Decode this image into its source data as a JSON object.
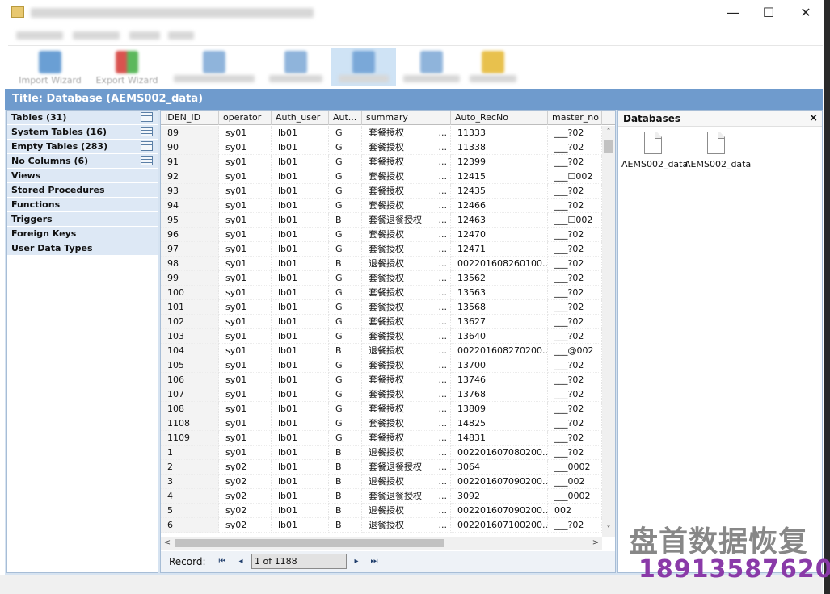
{
  "window": {
    "minimize_glyph": "—",
    "maximize_glyph": "☐",
    "close_glyph": "✕"
  },
  "ribbon": {
    "import_label": "Import Wizard",
    "export_label": "Export Wizard"
  },
  "title_band": "Title: Database (AEMS002_data)",
  "nav": {
    "items": [
      {
        "label": "Tables (31)",
        "has_grid_icon": true
      },
      {
        "label": "System Tables (16)",
        "has_grid_icon": true
      },
      {
        "label": "Empty Tables (283)",
        "has_grid_icon": true
      },
      {
        "label": "No Columns (6)",
        "has_grid_icon": true
      },
      {
        "label": "Views"
      },
      {
        "label": "Stored Procedures"
      },
      {
        "label": "Functions"
      },
      {
        "label": "Triggers"
      },
      {
        "label": "Foreign Keys"
      },
      {
        "label": "User Data Types"
      }
    ]
  },
  "grid": {
    "columns": [
      "IDEN_ID",
      "operator",
      "Auth_user",
      "Aut...",
      "summary",
      "Auto_RecNo",
      "master_no"
    ],
    "rows": [
      [
        "89",
        "sy01",
        "lb01",
        "G",
        "套餐授权",
        "11333",
        "___?02"
      ],
      [
        "90",
        "sy01",
        "lb01",
        "G",
        "套餐授权",
        "11338",
        "___?02"
      ],
      [
        "91",
        "sy01",
        "lb01",
        "G",
        "套餐授权",
        "12399",
        "___?02"
      ],
      [
        "92",
        "sy01",
        "lb01",
        "G",
        "套餐授权",
        "12415",
        "___☐002"
      ],
      [
        "93",
        "sy01",
        "lb01",
        "G",
        "套餐授权",
        "12435",
        "___?02"
      ],
      [
        "94",
        "sy01",
        "lb01",
        "G",
        "套餐授权",
        "12466",
        "___?02"
      ],
      [
        "95",
        "sy01",
        "lb01",
        "B",
        "套餐退餐授权",
        "12463",
        "___☐002"
      ],
      [
        "96",
        "sy01",
        "lb01",
        "G",
        "套餐授权",
        "12470",
        "___?02"
      ],
      [
        "97",
        "sy01",
        "lb01",
        "G",
        "套餐授权",
        "12471",
        "___?02"
      ],
      [
        "98",
        "sy01",
        "lb01",
        "B",
        "退餐授权",
        "002201608260100...",
        "___?02"
      ],
      [
        "99",
        "sy01",
        "lb01",
        "G",
        "套餐授权",
        "13562",
        "___?02"
      ],
      [
        "100",
        "sy01",
        "lb01",
        "G",
        "套餐授权",
        "13563",
        "___?02"
      ],
      [
        "101",
        "sy01",
        "lb01",
        "G",
        "套餐授权",
        "13568",
        "___?02"
      ],
      [
        "102",
        "sy01",
        "lb01",
        "G",
        "套餐授权",
        "13627",
        "___?02"
      ],
      [
        "103",
        "sy01",
        "lb01",
        "G",
        "套餐授权",
        "13640",
        "___?02"
      ],
      [
        "104",
        "sy01",
        "lb01",
        "B",
        "退餐授权",
        "002201608270200...",
        "___@002"
      ],
      [
        "105",
        "sy01",
        "lb01",
        "G",
        "套餐授权",
        "13700",
        "___?02"
      ],
      [
        "106",
        "sy01",
        "lb01",
        "G",
        "套餐授权",
        "13746",
        "___?02"
      ],
      [
        "107",
        "sy01",
        "lb01",
        "G",
        "套餐授权",
        "13768",
        "___?02"
      ],
      [
        "108",
        "sy01",
        "lb01",
        "G",
        "套餐授权",
        "13809",
        "___?02"
      ],
      [
        "1108",
        "sy01",
        "lb01",
        "G",
        "套餐授权",
        "14825",
        "___?02"
      ],
      [
        "1109",
        "sy01",
        "lb01",
        "G",
        "套餐授权",
        "14831",
        "___?02"
      ],
      [
        "1",
        "sy01",
        "lb01",
        "B",
        "退餐授权",
        "002201607080200...",
        "___?02"
      ],
      [
        "2",
        "sy02",
        "lb01",
        "B",
        "套餐退餐授权",
        "3064",
        "___0002"
      ],
      [
        "3",
        "sy02",
        "lb01",
        "B",
        "退餐授权",
        "002201607090200...",
        "___002"
      ],
      [
        "4",
        "sy02",
        "lb01",
        "B",
        "套餐退餐授权",
        "3092",
        "___0002"
      ],
      [
        "5",
        "sy02",
        "lb01",
        "B",
        "退餐授权",
        "002201607090200...",
        "002"
      ],
      [
        "6",
        "sy02",
        "lb01",
        "B",
        "退餐授权",
        "002201607100200...",
        "___?02"
      ]
    ],
    "ellipsis": "...",
    "scroll_up_glyph": "˄",
    "scroll_down_glyph": "˅",
    "scroll_left_glyph": "<",
    "scroll_right_glyph": ">"
  },
  "record_nav": {
    "label": "Record:",
    "position": "1 of 1188",
    "first_glyph": "⏮",
    "prev_glyph": "◂",
    "next_glyph": "▸",
    "last_glyph": "⏭"
  },
  "databases_panel": {
    "title": "Databases",
    "close_glyph": "×",
    "items": [
      "AEMS002_data",
      "AEMS002_data"
    ]
  },
  "watermark": {
    "text": "盘首数据恢复",
    "phone": "18913587620"
  }
}
